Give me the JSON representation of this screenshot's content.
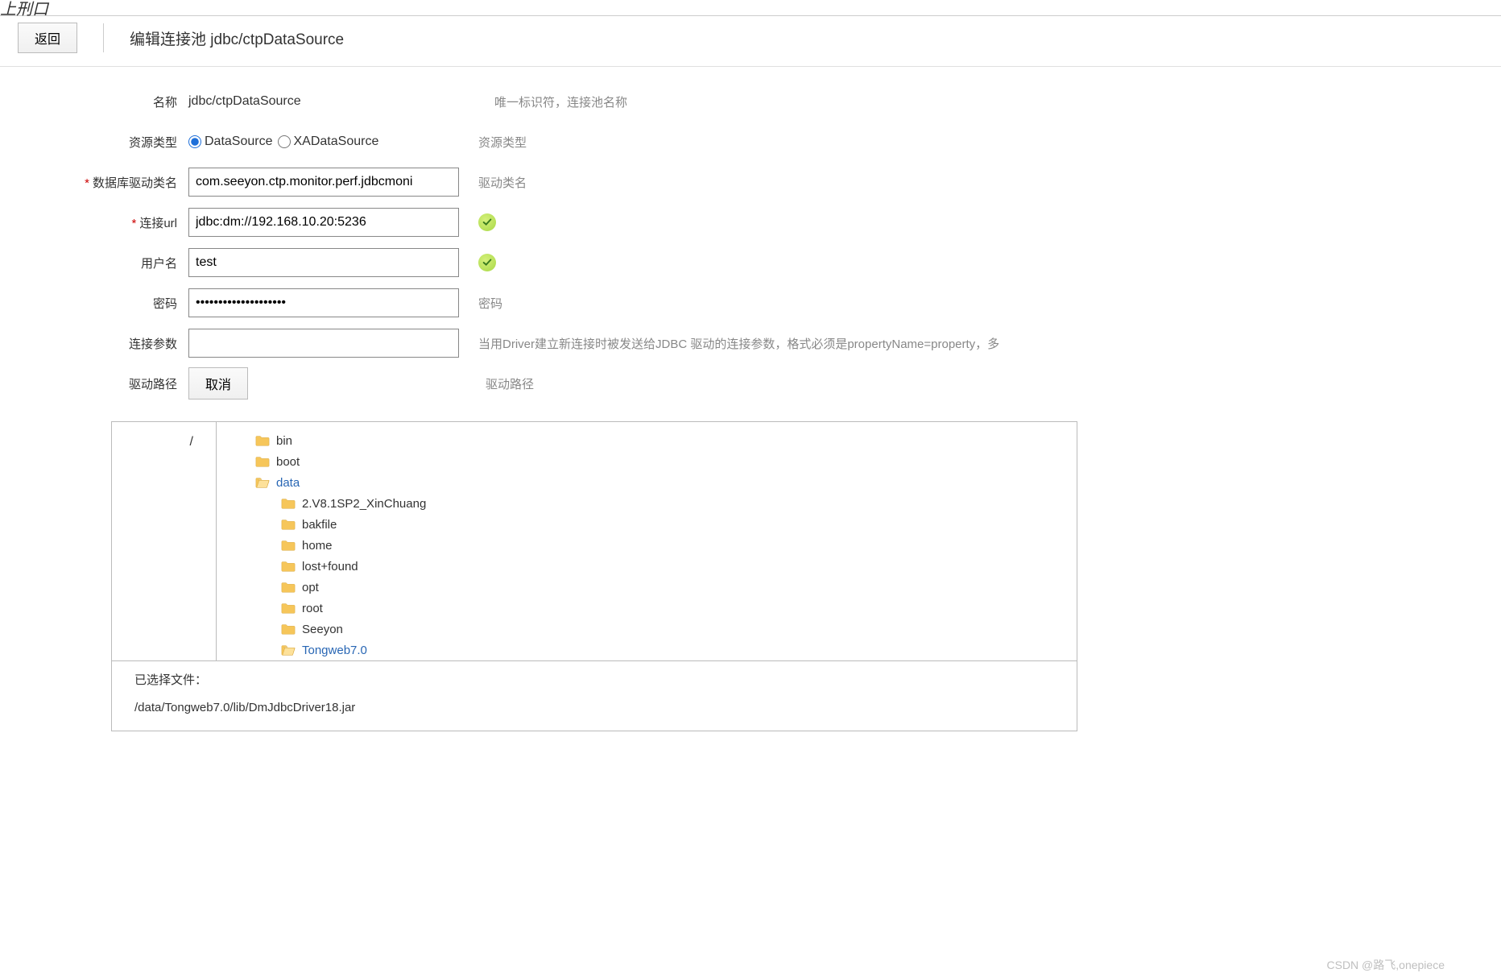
{
  "header": {
    "fragment_text": "上刑口",
    "back_label": "返回",
    "title": "编辑连接池 jdbc/ctpDataSource"
  },
  "form": {
    "name": {
      "label": "名称",
      "value": "jdbc/ctpDataSource",
      "help": "唯一标识符，连接池名称"
    },
    "resource_type": {
      "label": "资源类型",
      "option1": "DataSource",
      "option2": "XADataSource",
      "help": "资源类型"
    },
    "driver_class": {
      "label": "数据库驱动类名",
      "value": "com.seeyon.ctp.monitor.perf.jdbcmoni",
      "help": "驱动类名"
    },
    "url": {
      "label": "连接url",
      "value": "jdbc:dm://192.168.10.20:5236"
    },
    "username": {
      "label": "用户名",
      "value": "test"
    },
    "password": {
      "label": "密码",
      "value": "••••••••••••••••••••",
      "help": "密码"
    },
    "conn_params": {
      "label": "连接参数",
      "value": "",
      "help": "当用Driver建立新连接时被发送给JDBC 驱动的连接参数，格式必须是propertyName=property，多"
    },
    "driver_path": {
      "label": "驱动路径",
      "cancel_label": "取消",
      "help": "驱动路径"
    }
  },
  "tree": {
    "root_label": "/",
    "items": [
      {
        "name": "bin",
        "indent": 1,
        "open": false,
        "link": false
      },
      {
        "name": "boot",
        "indent": 1,
        "open": false,
        "link": false
      },
      {
        "name": "data",
        "indent": 1,
        "open": true,
        "link": true
      },
      {
        "name": "2.V8.1SP2_XinChuang",
        "indent": 2,
        "open": false,
        "link": false
      },
      {
        "name": "bakfile",
        "indent": 2,
        "open": false,
        "link": false
      },
      {
        "name": "home",
        "indent": 2,
        "open": false,
        "link": false
      },
      {
        "name": "lost+found",
        "indent": 2,
        "open": false,
        "link": false
      },
      {
        "name": "opt",
        "indent": 2,
        "open": false,
        "link": false
      },
      {
        "name": "root",
        "indent": 2,
        "open": false,
        "link": false
      },
      {
        "name": "Seeyon",
        "indent": 2,
        "open": false,
        "link": false
      },
      {
        "name": "Tongweb7.0",
        "indent": 2,
        "open": true,
        "link": true
      }
    ]
  },
  "selected": {
    "label": "已选择文件：",
    "path": "/data/Tongweb7.0/lib/DmJdbcDriver18.jar"
  },
  "watermark": "CSDN @路飞,onepiece"
}
